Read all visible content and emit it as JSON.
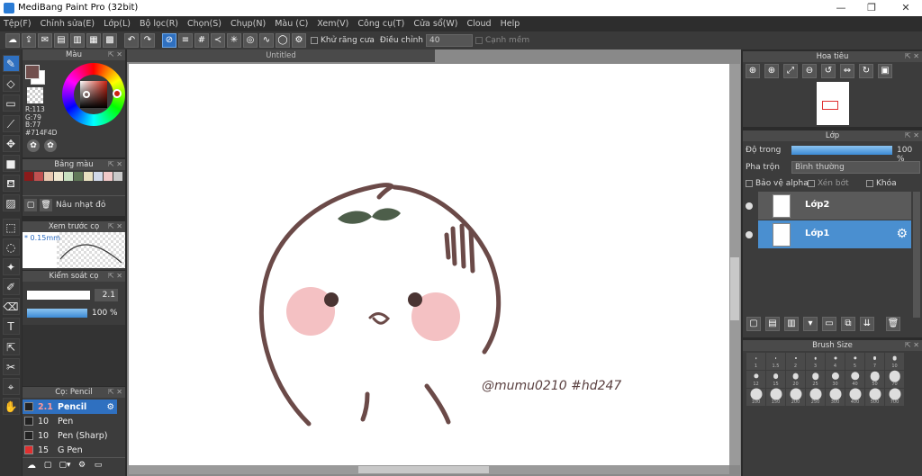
{
  "window": {
    "title": "MediBang Paint Pro (32bit)",
    "minimize": "—",
    "maximize": "❐",
    "close": "✕"
  },
  "menu": [
    "Tệp(F)",
    "Chỉnh sửa(E)",
    "Lớp(L)",
    "Bộ lọc(R)",
    "Chọn(S)",
    "Chụp(N)",
    "Màu (C)",
    "Xem(V)",
    "Công cụ(T)",
    "Cửa sổ(W)",
    "Cloud",
    "Help"
  ],
  "toolbar": {
    "antialias_label": "Khử răng cưa",
    "adjust_label": "Điều chỉnh",
    "adjust_value": "40",
    "snap_label": "Cạnh mềm"
  },
  "color_panel": {
    "title": "Màu",
    "r": "R:113",
    "g": "G:79",
    "b": "B:77",
    "hex": "#714F4D",
    "colors": {
      "fg": "#714f4d",
      "bg": "#ffffff"
    }
  },
  "palette_panel": {
    "title": "Bảng màu",
    "swatches": [
      "#8b1a1a",
      "#c05050",
      "#e8c8b0",
      "#f0e8d0",
      "#c8e0c0",
      "#607858",
      "#e8e0c0",
      "#d0d8e8",
      "#f0c8c8",
      "#c8c8c8"
    ],
    "current_name": "Nâu nhạt đỏ"
  },
  "preview_panel": {
    "title": "Xem trước cọ",
    "size_label": "* 0.15mm"
  },
  "brush_control": {
    "title": "Kiểm soát cọ",
    "size_value": "2.1",
    "opacity_value": "100 %",
    "opacity": 1.0
  },
  "brush_list": {
    "title": "Cọ: Pencil",
    "items": [
      {
        "size": "2.1",
        "name": "Pencil",
        "color": "#222222",
        "selected": true
      },
      {
        "size": "10",
        "name": "Pen",
        "color": "#222222",
        "selected": false
      },
      {
        "size": "10",
        "name": "Pen (Sharp)",
        "color": "#222222",
        "selected": false
      },
      {
        "size": "15",
        "name": "G Pen",
        "color": "#e03030",
        "selected": false
      }
    ]
  },
  "canvas": {
    "tab_title": "Untitled",
    "signature": "@mumu0210 #hd247"
  },
  "navigator": {
    "title": "Hoa tiêu"
  },
  "layers": {
    "title": "Lớp",
    "opacity_label": "Độ trong",
    "opacity_value": "100 %",
    "opacity": 1.0,
    "blend_label": "Pha trộn",
    "blend_value": "Bình thường",
    "alpha_protect": "Bảo vệ alpha",
    "clipping": "Xén bớt",
    "lock": "Khóa",
    "items": [
      {
        "name": "Lớp2",
        "selected": false
      },
      {
        "name": "Lớp1",
        "selected": true
      }
    ]
  },
  "brush_size": {
    "title": "Brush Size",
    "sizes": [
      "1",
      "1.5",
      "2",
      "3",
      "4",
      "5",
      "7",
      "10",
      "12",
      "15",
      "20",
      "25",
      "30",
      "40",
      "50",
      "70",
      "100",
      "150",
      "200",
      "250",
      "300",
      "400",
      "500",
      "700"
    ]
  }
}
